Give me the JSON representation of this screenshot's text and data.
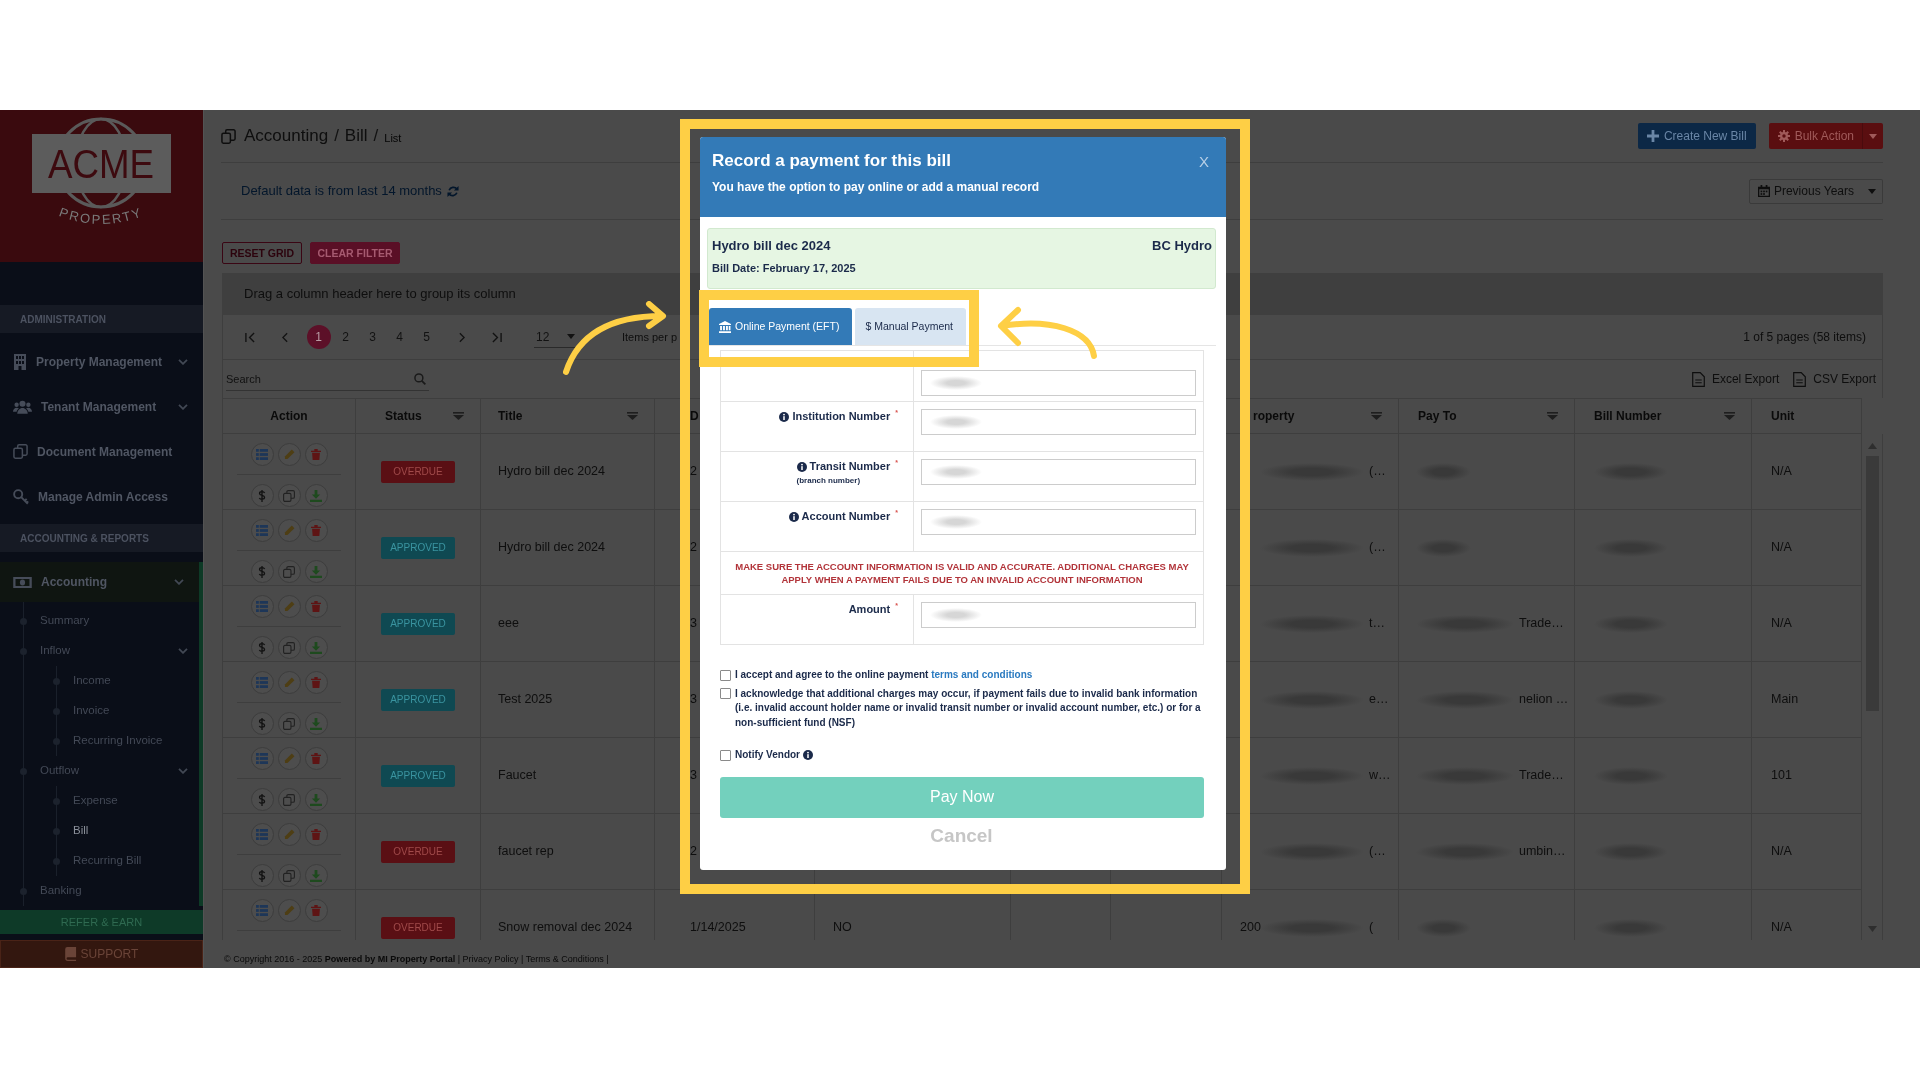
{
  "sidebar": {
    "logo": {
      "name": "ACME",
      "tagline": "PROPERTY"
    },
    "sections": [
      {
        "title": "ADMINISTRATION",
        "items": [
          {
            "label": "Property Management",
            "expanded": false,
            "selected": false
          },
          {
            "label": "Tenant Management",
            "expanded": false,
            "selected": false
          },
          {
            "label": "Document Management",
            "selected": false
          },
          {
            "label": "Manage Admin Access",
            "selected": false
          }
        ]
      },
      {
        "title": "ACCOUNTING & REPORTS",
        "items": [
          {
            "label": "Accounting",
            "expanded": true,
            "selected": false,
            "children": [
              {
                "label": "Summary",
                "selected": false
              },
              {
                "label": "Inflow",
                "expanded": true,
                "selected": false,
                "children": [
                  {
                    "label": "Income",
                    "selected": false
                  },
                  {
                    "label": "Invoice",
                    "selected": false
                  },
                  {
                    "label": "Recurring Invoice",
                    "selected": false
                  }
                ]
              },
              {
                "label": "Outflow",
                "expanded": true,
                "selected": false,
                "children": [
                  {
                    "label": "Expense",
                    "selected": false
                  },
                  {
                    "label": "Bill",
                    "selected": true
                  },
                  {
                    "label": "Recurring Bill",
                    "selected": false
                  }
                ]
              },
              {
                "label": "Banking",
                "selected": false
              }
            ]
          }
        ]
      }
    ],
    "refer": "REFER & EARN",
    "support": "SUPPORT"
  },
  "header": {
    "breadcrumb": [
      "Accounting",
      "Bill",
      "List"
    ],
    "separator": "/",
    "actions": [
      {
        "label": "Create New Bill",
        "kind": "create"
      },
      {
        "label": "Bulk Action",
        "kind": "bulk"
      }
    ]
  },
  "filter_bar": {
    "notice": "Default data is from last 14 months",
    "period": "Previous Years"
  },
  "grid": {
    "tools": [
      {
        "label": "RESET GRID",
        "kind": "outline"
      },
      {
        "label": "CLEAR FILTER",
        "kind": "filled"
      }
    ],
    "group_hint": "Drag a column header here to group its column",
    "pages": [
      {
        "label": "1",
        "selected": true
      },
      {
        "label": "2",
        "selected": false
      },
      {
        "label": "3",
        "selected": false
      },
      {
        "label": "4",
        "selected": false
      },
      {
        "label": "5",
        "selected": false
      }
    ],
    "page_size": "12",
    "page_size_label": "Items per p",
    "page_info": "1 of 5 pages (58 items)",
    "search": {
      "placeholder": "Search"
    },
    "exports": [
      "Excel Export",
      "CSV Export"
    ],
    "columns": [
      {
        "label": "Action",
        "filter": false
      },
      {
        "label": "Status",
        "filter": true
      },
      {
        "label": "Title",
        "filter": true
      },
      {
        "label": "D"
      },
      {
        "label": "roperty",
        "filter": true
      },
      {
        "label": "Pay To",
        "filter": true
      },
      {
        "label": "Bill Number",
        "filter": true
      },
      {
        "label": "Unit",
        "filter": false
      }
    ],
    "rows": [
      {
        "status": {
          "label": "OVERDUE",
          "kind": "overdue"
        },
        "title": "Hydro bill dec 2024",
        "column_4": "2",
        "property_end": "(…",
        "unit": "N/A",
        "redacted": true
      },
      {
        "status": {
          "label": "APPROVED",
          "kind": "approved"
        },
        "title": "Hydro bill dec 2024",
        "column_4": "2",
        "property_end": "(…",
        "unit": "N/A",
        "redacted": true
      },
      {
        "status": {
          "label": "APPROVED",
          "kind": "approved"
        },
        "title": "eee",
        "column_4": "3",
        "property_end": "t…",
        "pay_to_end": "Trade…",
        "unit": "N/A",
        "redacted": true
      },
      {
        "status": {
          "label": "APPROVED",
          "kind": "approved"
        },
        "title": "Test 2025",
        "column_4": "3",
        "property_end": "e…",
        "pay_to_end": "nelion …",
        "unit": "Main",
        "redacted": true
      },
      {
        "status": {
          "label": "APPROVED",
          "kind": "approved"
        },
        "title": "Faucet",
        "column_4": "3",
        "property_end": "w…",
        "pay_to_end": "Trade…",
        "unit": "101",
        "redacted": true
      },
      {
        "status": {
          "label": "OVERDUE",
          "kind": "overdue"
        },
        "title": "faucet rep",
        "column_4": "2",
        "property_end": "(…",
        "pay_to_end": "umbin…",
        "unit": "N/A",
        "redacted": true
      },
      {
        "status": {
          "label": "OVERDUE",
          "kind": "overdue"
        },
        "title": "Snow removal dec 2024",
        "column_4": "1/14/2025",
        "column_5": "NO",
        "property_start": "200",
        "property_end": "(",
        "unit": "N/A",
        "redacted": true
      }
    ]
  },
  "footer": "© Copyright 2016 - 2025 **Powered by MI Property Portal** | Privacy Policy | Terms & Conditions |",
  "modal": {
    "title": "Record a payment for this bill",
    "subtitle": "You have the option to pay online or add a manual record",
    "close": "X",
    "bill": {
      "title": "Hydro bill dec 2024",
      "vendor": "BC Hydro",
      "date": "Bill Date: February 17, 2025"
    },
    "tabs": [
      {
        "label": "Online Payment (EFT)",
        "kind": "online",
        "selected": true
      },
      {
        "label": "$ Manual Payment",
        "kind": "manual",
        "selected": false
      }
    ],
    "fields": [
      {
        "kind": "input",
        "redacted": true
      },
      {
        "kind": "input",
        "label": "Institution Number $^{*}$",
        "info": true,
        "redacted": true
      },
      {
        "kind": "input",
        "label": "Transit Number $^{*}$",
        "note": "(branch number)",
        "info": true,
        "redacted": true
      },
      {
        "kind": "input",
        "label": "Account Number $^{*}$",
        "info": true,
        "redacted": true
      },
      {
        "kind": "warning",
        "text": "MAKE SURE THE ACCOUNT INFORMATION IS VALID AND ACCURATE. ADDITIONAL CHARGES MAY APPLY WHEN A PAYMENT FAILS DUE TO AN INVALID ACCOUNT INFORMATION"
      },
      {
        "kind": "input",
        "label": "Amount $^{*}$",
        "redacted": true
      }
    ],
    "agreements": [
      {
        "text": "I accept and agree to the online payment",
        "link": "terms and conditions",
        "checked": false
      },
      {
        "text": "I acknowledge that additional charges may occur, if payment fails due to invalid bank information (i.e. invalid account holder name or invalid transit number or invalid account number, etc.) or for a non-sufficient fund (NSF)",
        "checked": false
      },
      {
        "text": "Notify Vendor",
        "info": true,
        "checked": false
      }
    ],
    "primary": "Pay Now",
    "secondary": "Cancel"
  }
}
